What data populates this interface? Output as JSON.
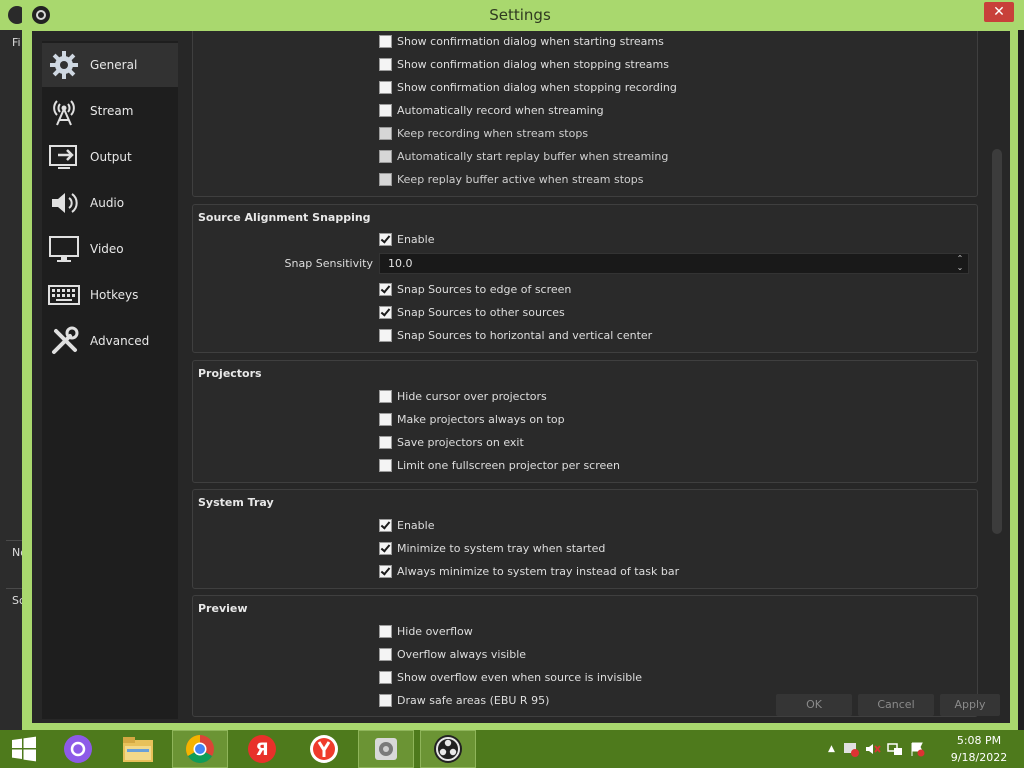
{
  "window": {
    "title": "Settings",
    "close_glyph": "✕"
  },
  "background_app": {
    "labels": [
      "Fi",
      "No",
      "Sc"
    ]
  },
  "sidebar": {
    "items": [
      {
        "label": "General",
        "icon": "gear-icon",
        "active": true
      },
      {
        "label": "Stream",
        "icon": "broadcast-antenna-icon",
        "active": false
      },
      {
        "label": "Output",
        "icon": "output-monitor-icon",
        "active": false
      },
      {
        "label": "Audio",
        "icon": "speaker-icon",
        "active": false
      },
      {
        "label": "Video",
        "icon": "monitor-icon",
        "active": false
      },
      {
        "label": "Hotkeys",
        "icon": "keyboard-icon",
        "active": false
      },
      {
        "label": "Advanced",
        "icon": "tools-icon",
        "active": false
      }
    ]
  },
  "groups": {
    "streaming": {
      "items": [
        {
          "label": "Show confirmation dialog when starting streams",
          "checked": false,
          "dim": false
        },
        {
          "label": "Show confirmation dialog when stopping streams",
          "checked": false,
          "dim": false
        },
        {
          "label": "Show confirmation dialog when stopping recording",
          "checked": false,
          "dim": false
        },
        {
          "label": "Automatically record when streaming",
          "checked": false,
          "dim": false
        },
        {
          "label": "Keep recording when stream stops",
          "checked": false,
          "dim": true
        },
        {
          "label": "Automatically start replay buffer when streaming",
          "checked": false,
          "dim": true
        },
        {
          "label": "Keep replay buffer active when stream stops",
          "checked": false,
          "dim": true
        }
      ]
    },
    "snapping": {
      "title": "Source Alignment Snapping",
      "enable": {
        "label": "Enable",
        "checked": true
      },
      "sensitivity": {
        "label": "Snap Sensitivity",
        "value": "10.0"
      },
      "items": [
        {
          "label": "Snap Sources to edge of screen",
          "checked": true
        },
        {
          "label": "Snap Sources to other sources",
          "checked": true
        },
        {
          "label": "Snap Sources to horizontal and vertical center",
          "checked": false
        }
      ]
    },
    "projectors": {
      "title": "Projectors",
      "items": [
        {
          "label": "Hide cursor over projectors",
          "checked": false
        },
        {
          "label": "Make projectors always on top",
          "checked": false
        },
        {
          "label": "Save projectors on exit",
          "checked": false
        },
        {
          "label": "Limit one fullscreen projector per screen",
          "checked": false
        }
      ]
    },
    "tray": {
      "title": "System Tray",
      "items": [
        {
          "label": "Enable",
          "checked": true
        },
        {
          "label": "Minimize to system tray when started",
          "checked": true
        },
        {
          "label": "Always minimize to system tray instead of task bar",
          "checked": true
        }
      ]
    },
    "preview": {
      "title": "Preview",
      "items": [
        {
          "label": "Hide overflow",
          "checked": false
        },
        {
          "label": "Overflow always visible",
          "checked": false
        },
        {
          "label": "Show overflow even when source is invisible",
          "checked": false
        },
        {
          "label": "Draw safe areas (EBU R 95)",
          "checked": false
        }
      ]
    }
  },
  "buttons": {
    "ok": "OK",
    "cancel": "Cancel",
    "apply": "Apply"
  },
  "taskbar": {
    "apps": [
      {
        "name": "start-button",
        "icon": "windows-logo-icon"
      },
      {
        "name": "alice-assistant",
        "icon": "alice-icon"
      },
      {
        "name": "file-explorer",
        "icon": "folder-icon"
      },
      {
        "name": "chrome",
        "icon": "chrome-icon"
      },
      {
        "name": "yandex",
        "icon": "yandex-icon"
      },
      {
        "name": "yandex-browser",
        "icon": "yandex-browser-icon"
      },
      {
        "name": "media-app",
        "icon": "media-icon"
      },
      {
        "name": "obs-studio",
        "icon": "obs-icon"
      }
    ],
    "clock": {
      "time": "5:08 PM",
      "date": "9/18/2022"
    }
  },
  "colors": {
    "accent_green": "#a9d86e",
    "taskbar_green": "#4e7a1c",
    "dark_bg": "#272727",
    "close_red": "#c8403a"
  }
}
